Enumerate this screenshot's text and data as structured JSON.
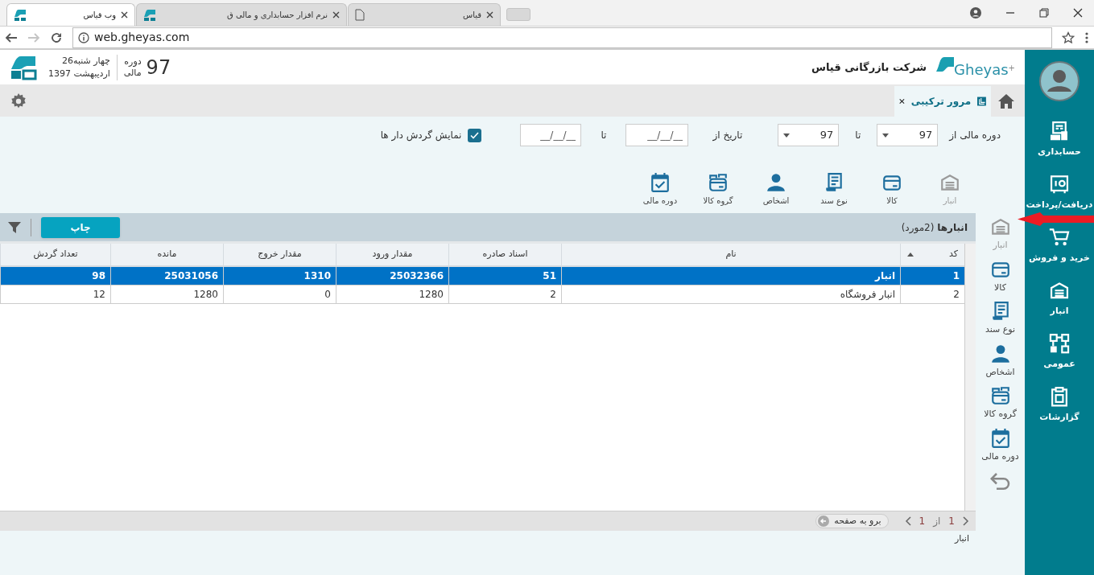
{
  "browser": {
    "tabs": [
      {
        "title": "قیاس",
        "kind": "blank",
        "selected": false
      },
      {
        "title": "نرم افزار حسابداری و مالی ق",
        "kind": "site",
        "selected": false
      },
      {
        "title": "وب قیاس",
        "kind": "site",
        "selected": true
      }
    ],
    "url": "web.gheyas.com"
  },
  "header": {
    "date_day": "چهار شنبه26",
    "date_month": "اردیبهشت 1397",
    "period_label_1": "دوره",
    "period_label_2": "مالی",
    "period_value": "97",
    "company": "شرکت بازرگانی قیاس",
    "logo_text": "Gheyas",
    "logo_mark": "+"
  },
  "app_tabs": [
    {
      "label": "مرور ترکیبی",
      "selected": true
    }
  ],
  "filters": {
    "fiscal_from_label": "دوره مالی از",
    "fiscal_from": "97",
    "fiscal_to_label": "تا",
    "fiscal_to": "97",
    "date_from_label": "تاریخ از",
    "date_from_placeholder": "__/__/__",
    "date_to_label": "تا",
    "date_to_placeholder": "__/__/__",
    "show_active": {
      "label": "نمایش گردش دار ها",
      "checked": true
    }
  },
  "toolbar": [
    {
      "label": "انبار",
      "kind": "warehouse",
      "disabled": true
    },
    {
      "label": "کالا",
      "kind": "goods",
      "disabled": false
    },
    {
      "label": "نوع سند",
      "kind": "doctype",
      "disabled": false
    },
    {
      "label": "اشخاص",
      "kind": "person",
      "disabled": false
    },
    {
      "label": "گروه کالا",
      "kind": "goodsgroup",
      "disabled": false
    },
    {
      "label": "دوره مالی",
      "kind": "calendar",
      "disabled": false
    }
  ],
  "grid": {
    "title": "انبارها",
    "count": "(2مورد)",
    "print_button": "چاپ",
    "columns": [
      {
        "label": "کد",
        "sorted": true
      },
      {
        "label": "نام",
        "sorted": false
      },
      {
        "label": "اسناد صادره",
        "sorted": false
      },
      {
        "label": "مقدار ورود",
        "sorted": false
      },
      {
        "label": "مقدار خروج",
        "sorted": false
      },
      {
        "label": "مانده",
        "sorted": false
      },
      {
        "label": "تعداد گردش",
        "sorted": false
      }
    ],
    "rows": [
      {
        "cells": [
          "1",
          "انبار",
          "51",
          "25032366",
          "1310",
          "25031056",
          "98"
        ],
        "selected": true
      },
      {
        "cells": [
          "2",
          "انبار فروشگاه",
          "2",
          "1280",
          "0",
          "1280",
          "12"
        ],
        "selected": false
      }
    ],
    "pager": {
      "page": "1",
      "of": "از",
      "total": "1",
      "goto": "برو به صفحه"
    }
  },
  "footer_label": "انبار",
  "side_list": [
    {
      "label": "انبار",
      "kind": "warehouse",
      "disabled": true
    },
    {
      "label": "کالا",
      "kind": "goods",
      "disabled": false
    },
    {
      "label": "نوع سند",
      "kind": "doctype",
      "disabled": false
    },
    {
      "label": "اشخاص",
      "kind": "person",
      "disabled": false
    },
    {
      "label": "گروه کالا",
      "kind": "goodsgroup",
      "disabled": false
    },
    {
      "label": "دوره مالی",
      "kind": "calendar",
      "disabled": false
    }
  ],
  "nav": [
    {
      "label": "حسابداری",
      "kind": "accounting"
    },
    {
      "label": "دریافت/پرداخت",
      "kind": "cash"
    },
    {
      "label": "خرید و فروش",
      "kind": "cart"
    },
    {
      "label": "انبار",
      "kind": "warehouse"
    },
    {
      "label": "عمومی",
      "kind": "general"
    },
    {
      "label": "گزارشات",
      "kind": "reports"
    }
  ]
}
